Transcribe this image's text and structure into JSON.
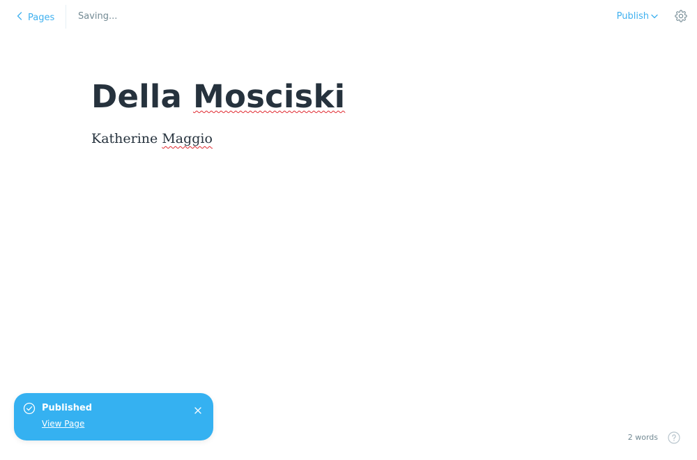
{
  "nav": {
    "back_label": "Pages",
    "back_icon": "chevron-left-icon"
  },
  "status": {
    "text": "Saving..."
  },
  "actions": {
    "publish_label": "Publish",
    "publish_icon": "chevron-down-icon",
    "settings_icon": "gear-icon"
  },
  "editor": {
    "title_first": "Della",
    "title_second": "Mosciski",
    "body_first": "Katherine",
    "body_second": "Maggio"
  },
  "toast": {
    "title": "Published",
    "link": "View Page",
    "icon": "check-circle-icon",
    "close_icon": "close-icon",
    "background": "#35b1f1"
  },
  "footer": {
    "word_count": "2 words",
    "help_icon": "question-circle-icon"
  },
  "colors": {
    "accent": "#3eb0ef",
    "text": "#26323d",
    "muted": "#738a94",
    "spellcheck": "#e0262d"
  }
}
